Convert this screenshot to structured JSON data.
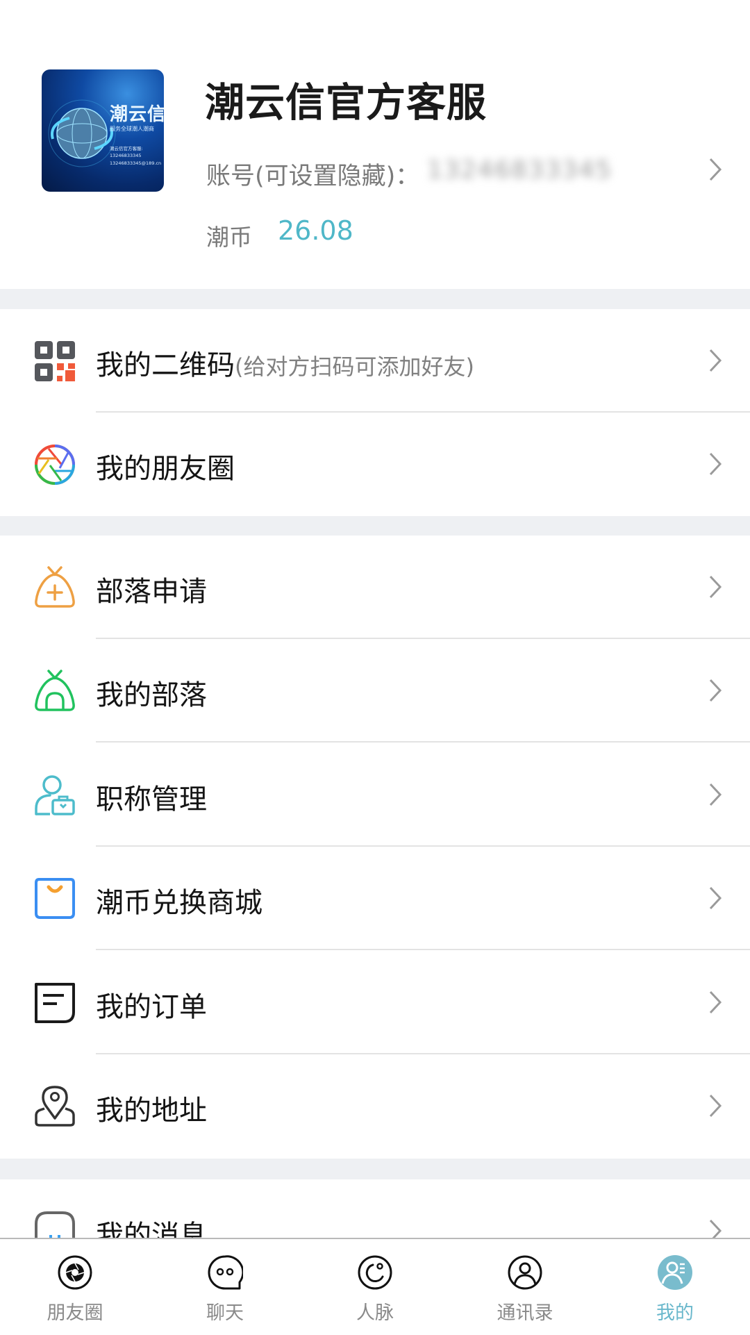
{
  "profile": {
    "name": "潮云信官方客服",
    "account_label": "账号(可设置隐藏)：",
    "account_value": "13246833345",
    "coin_label": "潮币",
    "coin_value": "26.08",
    "avatar": {
      "title": "潮云信",
      "subtitle": "服务全球潮人潮商",
      "line1": "潮云信官方客服:",
      "line2": "13246833345",
      "line3": "13246833345@189.cn"
    }
  },
  "menu_groups": [
    {
      "items": [
        {
          "label": "我的二维码",
          "hint": "(给对方扫码可添加好友)",
          "icon": "qr-code-icon"
        },
        {
          "label": "我的朋友圈",
          "hint": "",
          "icon": "moments-aperture-icon"
        }
      ]
    },
    {
      "items": [
        {
          "label": "部落申请",
          "icon": "tribe-apply-icon"
        },
        {
          "label": "我的部落",
          "icon": "my-tribe-icon"
        },
        {
          "label": "职称管理",
          "icon": "title-management-icon"
        },
        {
          "label": "潮币兑换商城",
          "icon": "shopping-bag-icon"
        },
        {
          "label": "我的订单",
          "icon": "order-icon"
        },
        {
          "label": "我的地址",
          "icon": "location-pin-icon"
        }
      ]
    },
    {
      "items": [
        {
          "label": "我的消息",
          "icon": "message-icon"
        }
      ]
    }
  ],
  "tabbar": {
    "tabs": [
      {
        "label": "朋友圈",
        "icon": "moments-icon",
        "active": false
      },
      {
        "label": "聊天",
        "icon": "chat-icon",
        "active": false
      },
      {
        "label": "人脉",
        "icon": "connections-icon",
        "active": false
      },
      {
        "label": "通讯录",
        "icon": "contacts-icon",
        "active": false
      },
      {
        "label": "我的",
        "icon": "me-icon",
        "active": true
      }
    ]
  },
  "colors": {
    "accent": "#4fb7c8",
    "active_tab": "#6ab8cc",
    "band": "#eef0f3",
    "qr_red": "#f05a3a",
    "tribe_orange": "#eea043",
    "tribe_green": "#21c25e",
    "title_teal": "#4dbccb",
    "bag_blue": "#3a8ef2"
  }
}
